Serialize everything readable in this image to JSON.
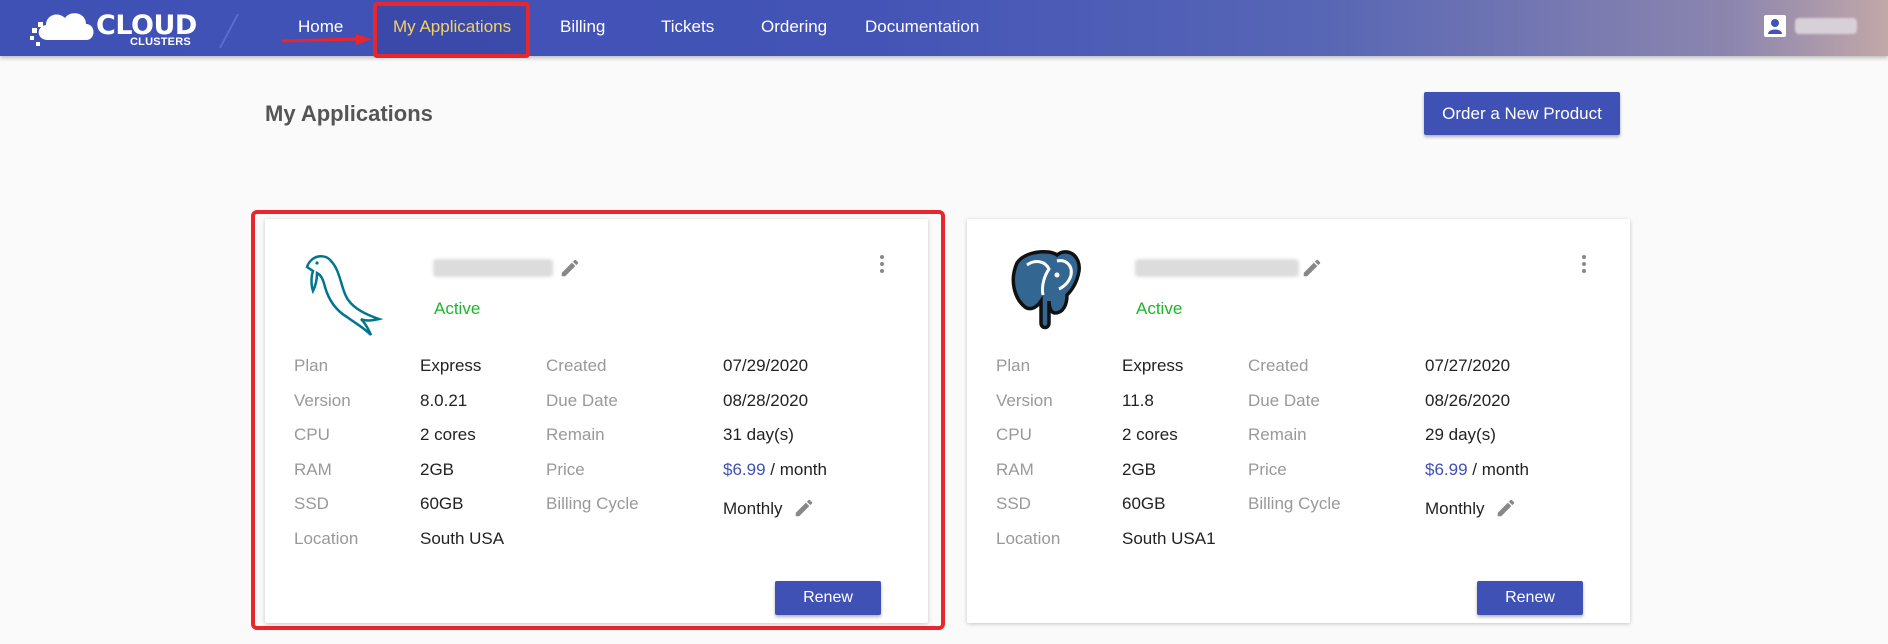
{
  "header": {
    "brand_line1": "CLOUD",
    "brand_line2": "CLUSTERS",
    "nav": [
      {
        "label": "Home"
      },
      {
        "label": "My Applications",
        "active": true
      },
      {
        "label": "Billing"
      },
      {
        "label": "Tickets"
      },
      {
        "label": "Ordering"
      },
      {
        "label": "Documentation"
      }
    ],
    "active_color": "#f4d35e",
    "bar_color": "#3f51b5"
  },
  "page": {
    "title": "My Applications",
    "order_button_label": "Order a New Product"
  },
  "labels": {
    "plan": "Plan",
    "version": "Version",
    "cpu": "CPU",
    "ram": "RAM",
    "ssd": "SSD",
    "location": "Location",
    "created": "Created",
    "due_date": "Due Date",
    "remain": "Remain",
    "price": "Price",
    "billing_cycle": "Billing Cycle",
    "renew": "Renew"
  },
  "cards": [
    {
      "logo_icon": "mysql-dolphin-icon",
      "status": "Active",
      "plan": "Express",
      "version": "8.0.21",
      "cpu": "2 cores",
      "ram": "2GB",
      "ssd": "60GB",
      "location": "South USA",
      "created": "07/29/2020",
      "due_date": "08/28/2020",
      "remain": "31 day(s)",
      "price_amount": "$6.99",
      "price_period": " / month",
      "billing_cycle": "Monthly"
    },
    {
      "logo_icon": "postgresql-elephant-icon",
      "status": "Active",
      "plan": "Express",
      "version": "11.8",
      "cpu": "2 cores",
      "ram": "2GB",
      "ssd": "60GB",
      "location": "South USA1",
      "created": "07/27/2020",
      "due_date": "08/26/2020",
      "remain": "29 day(s)",
      "price_amount": "$6.99",
      "price_period": " / month",
      "billing_cycle": "Monthly"
    }
  ],
  "colors": {
    "accent": "#3f51b5",
    "status_active": "#19b828",
    "highlight": "#e8262b"
  }
}
